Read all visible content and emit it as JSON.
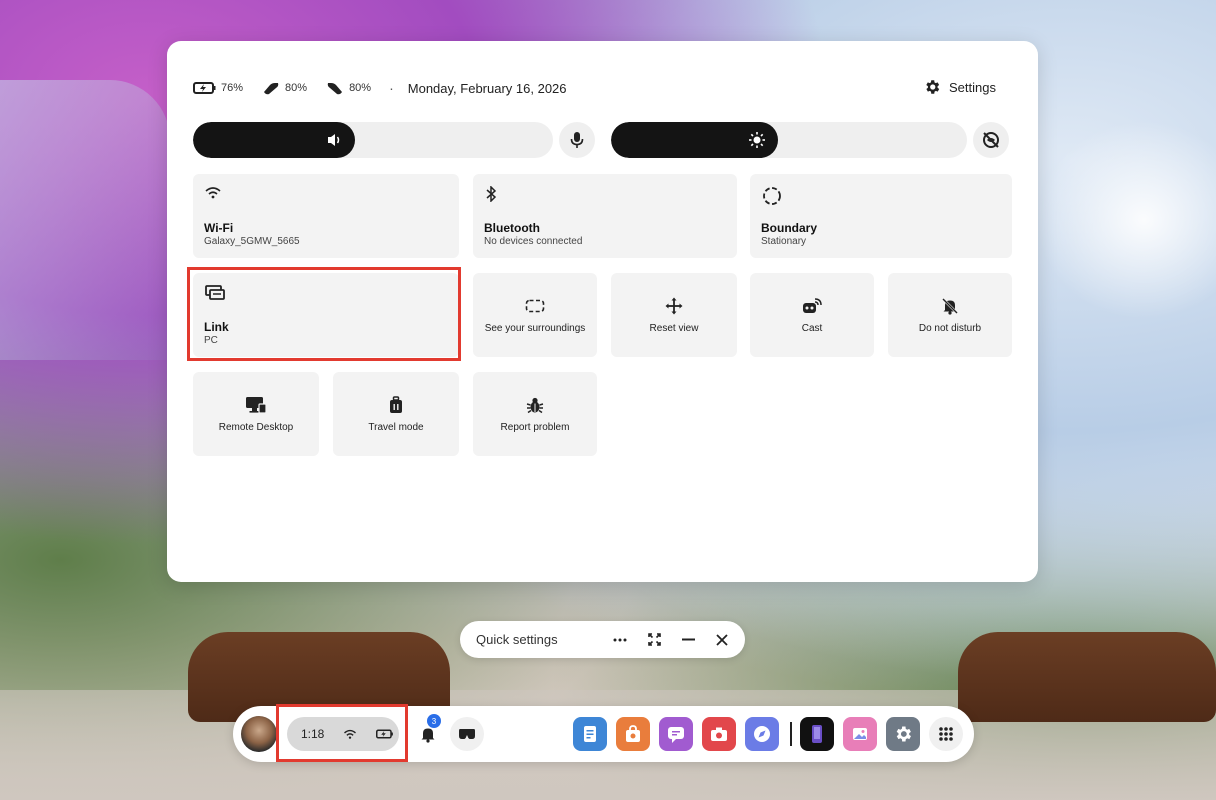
{
  "status": {
    "headset_battery": "76%",
    "controller_left_battery": "80%",
    "controller_right_battery": "80%",
    "separator": "·",
    "date": "Monday, February 16, 2026",
    "settings_label": "Settings"
  },
  "sliders": {
    "volume": 0.45,
    "brightness": 0.47
  },
  "tiles": {
    "wifi": {
      "title": "Wi-Fi",
      "sub": "Galaxy_5GMW_5665"
    },
    "bluetooth": {
      "title": "Bluetooth",
      "sub": "No devices connected"
    },
    "boundary": {
      "title": "Boundary",
      "sub": "Stationary"
    },
    "link": {
      "title": "Link",
      "sub": "PC"
    },
    "surroundings": {
      "label": "See your surroundings"
    },
    "reset_view": {
      "label": "Reset view"
    },
    "cast": {
      "label": "Cast"
    },
    "dnd": {
      "label": "Do not disturb"
    },
    "remote_desktop": {
      "label": "Remote Desktop"
    },
    "travel_mode": {
      "label": "Travel mode"
    },
    "report_problem": {
      "label": "Report problem"
    }
  },
  "window_bar": {
    "title": "Quick settings"
  },
  "taskbar": {
    "time": "1:18",
    "notification_count": "3"
  },
  "colors": {
    "highlight": "#e23a2f",
    "badge": "#2a6ee8"
  }
}
